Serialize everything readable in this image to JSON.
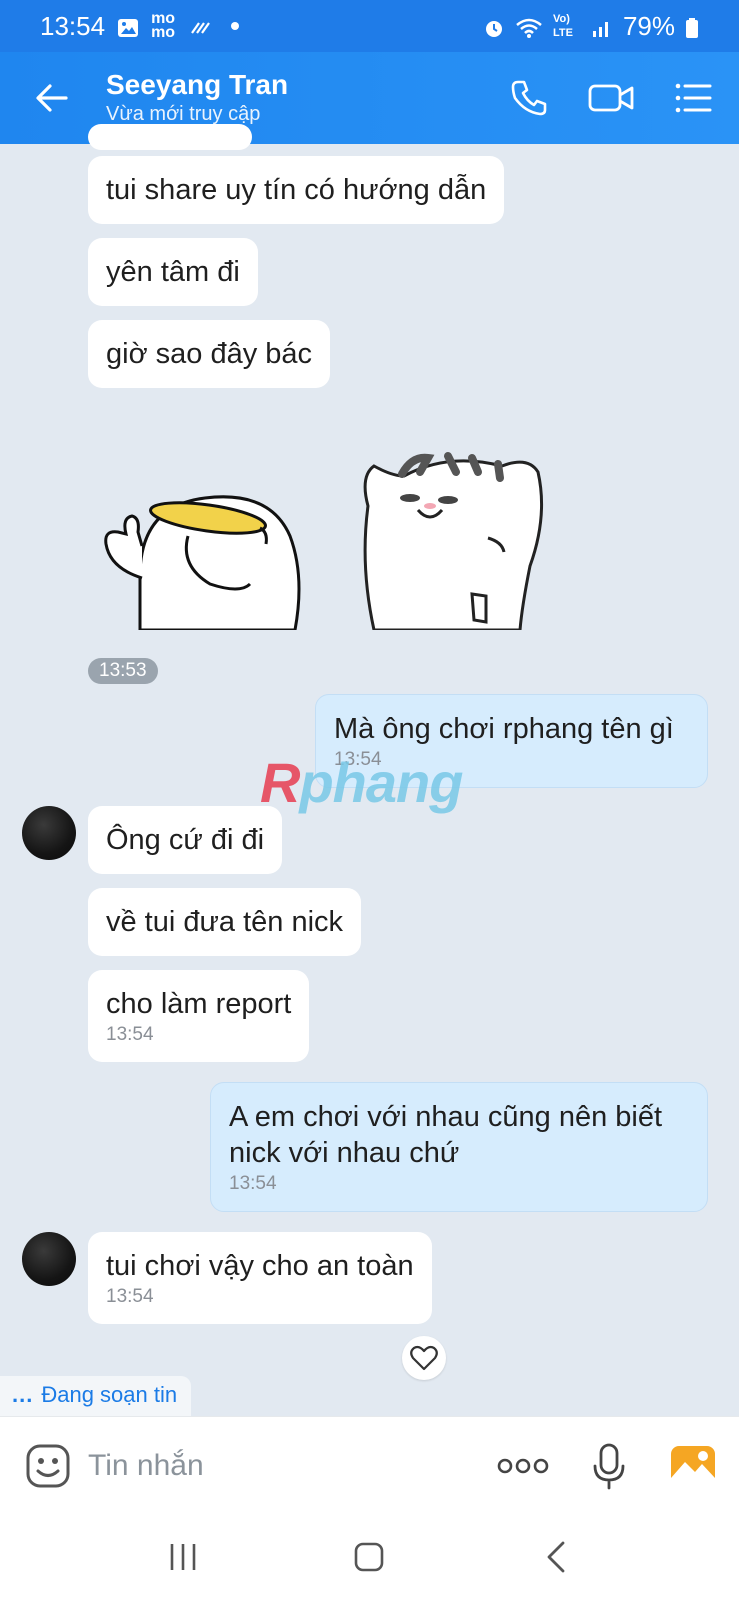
{
  "status_bar": {
    "time": "13:54",
    "momo_label": "mo mo",
    "network": "Vo) LTE",
    "battery": "79%"
  },
  "header": {
    "contact_name": "Seeyang Tran",
    "contact_status": "Vừa mới truy cập"
  },
  "messages": {
    "m1": {
      "text": "tui share uy tín có hướng dẫn"
    },
    "m2": {
      "text": "yên tâm đi"
    },
    "m3": {
      "text": "giờ sao đây bác"
    },
    "sticker_time": "13:53",
    "m4": {
      "text": "Mà ông chơi rphang tên gì",
      "time": "13:54"
    },
    "m5": {
      "text": "Ông cứ đi đi"
    },
    "m6": {
      "text": "về tui đưa tên nick"
    },
    "m7": {
      "text": "cho làm report",
      "time": "13:54"
    },
    "m8": {
      "text_line1": "A em chơi với nhau cũng nên biết",
      "text_line2": "nick với nhau chứ",
      "time": "13:54"
    },
    "m9": {
      "text": "tui chơi vậy cho an toàn",
      "time": "13:54"
    }
  },
  "watermark": {
    "r": "R",
    "rest": "phang"
  },
  "typing_indicator": {
    "dots": "...",
    "text": "Đang soạn tin"
  },
  "composer": {
    "placeholder": "Tin nhắn"
  },
  "colors": {
    "header": "#1f86ef",
    "bubble_out": "#d6ecfd",
    "background": "#e2e9f1"
  }
}
